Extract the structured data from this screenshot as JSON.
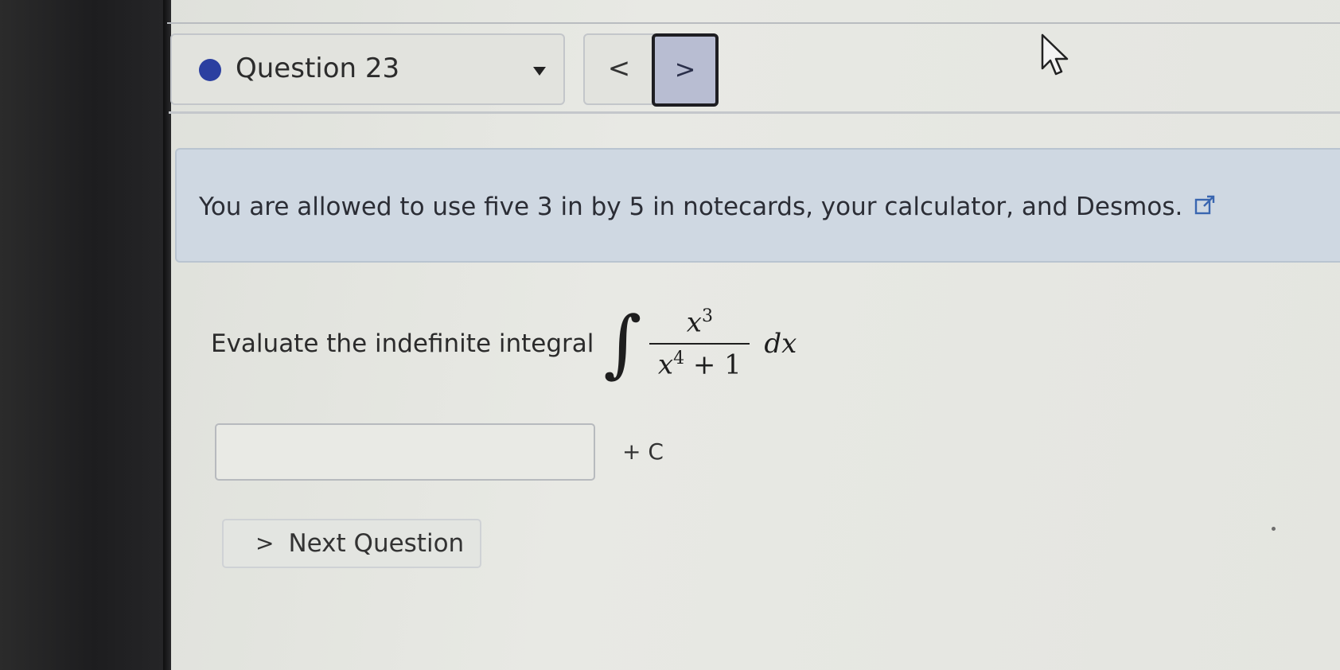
{
  "question_nav": {
    "label": "Question 23",
    "prev_symbol": "<",
    "next_symbol": ">"
  },
  "banner": {
    "text": "You are allowed to use five 3 in by 5 in notecards, your calculator, and Desmos."
  },
  "problem": {
    "prompt": "Evaluate the indefinite integral",
    "integral_sign": "∫",
    "numerator_base": "x",
    "numerator_exp": "3",
    "denominator_base": "x",
    "denominator_exp": "4",
    "denominator_tail": " + 1",
    "differential": "dx"
  },
  "answer": {
    "value": "",
    "suffix": "+ C"
  },
  "next_question": {
    "symbol": ">",
    "label": "Next Question"
  },
  "colors": {
    "question_dot": "#2b3fa0",
    "banner_bg": "#cfd8e2",
    "active_nav_bg": "#b8bdd2",
    "bezel": "#1d1d1f"
  },
  "icons": {
    "status": "filled-circle",
    "dropdown": "triangle-down",
    "external_link": "external-link-icon",
    "cursor": "mouse-pointer"
  }
}
